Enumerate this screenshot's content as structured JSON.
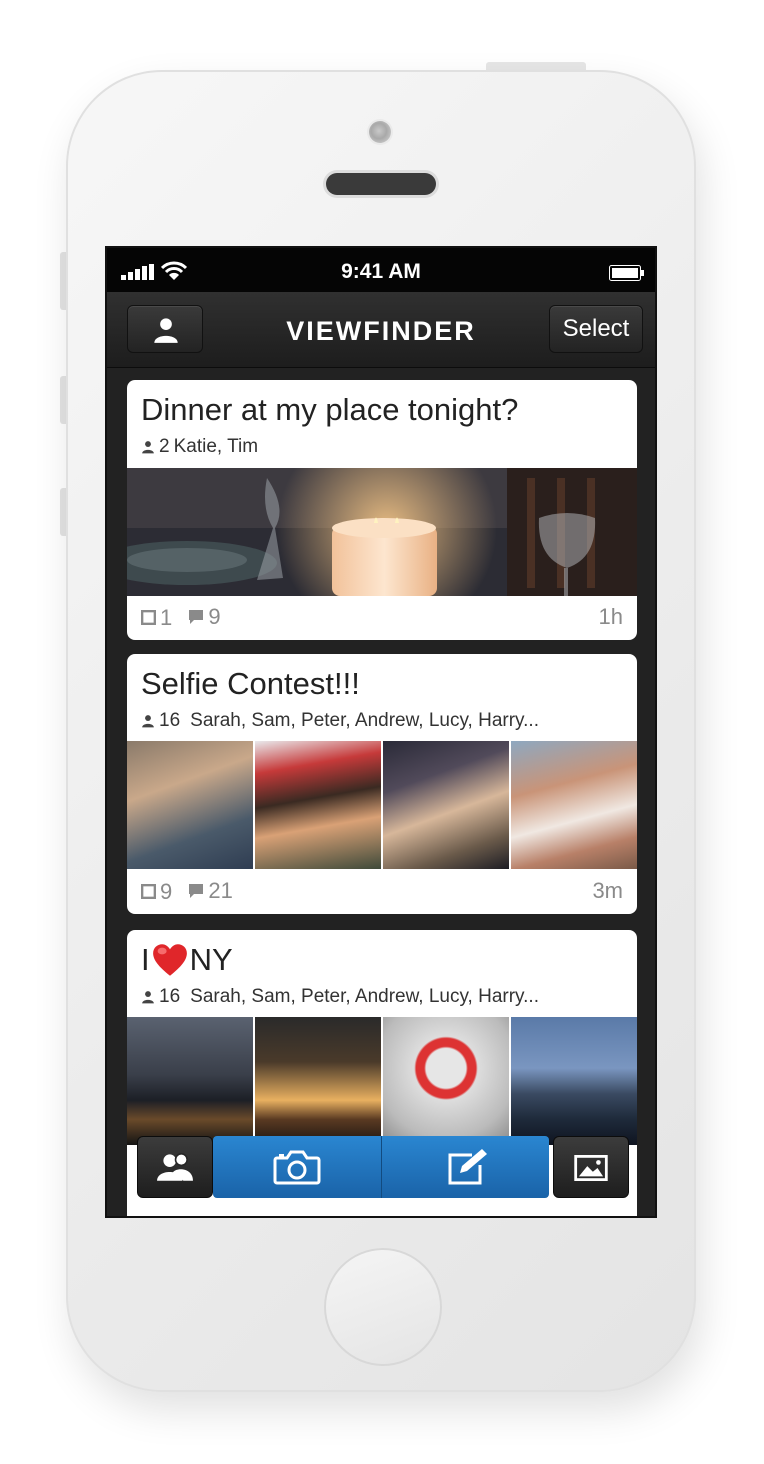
{
  "status_bar": {
    "time": "9:41 AM"
  },
  "nav": {
    "title": "VIEWFINDER",
    "right_button": "Select"
  },
  "cards": [
    {
      "title": "Dinner at my place tonight?",
      "people_count": "2",
      "people": "Katie, Tim",
      "photo_count": "1",
      "comment_count": "9",
      "age": "1h"
    },
    {
      "title": "Selfie Contest!!!",
      "people_count": "16",
      "people": "Sarah, Sam, Peter, Andrew, Lucy, Harry...",
      "photo_count": "9",
      "comment_count": "21",
      "age": "3m"
    },
    {
      "title_before": "I",
      "title_after": "NY",
      "people_count": "16",
      "people": "Sarah, Sam, Peter, Andrew, Lucy, Harry..."
    }
  ],
  "icons": {
    "profile": "person-icon",
    "contacts": "people-icon",
    "camera": "camera-icon",
    "compose": "compose-icon",
    "gallery": "photo-library-icon"
  },
  "colors": {
    "accent": "#2074bd",
    "nav_bg": "#262626",
    "card_bg": "#ffffff",
    "meta_gray": "#8a8a8a"
  }
}
